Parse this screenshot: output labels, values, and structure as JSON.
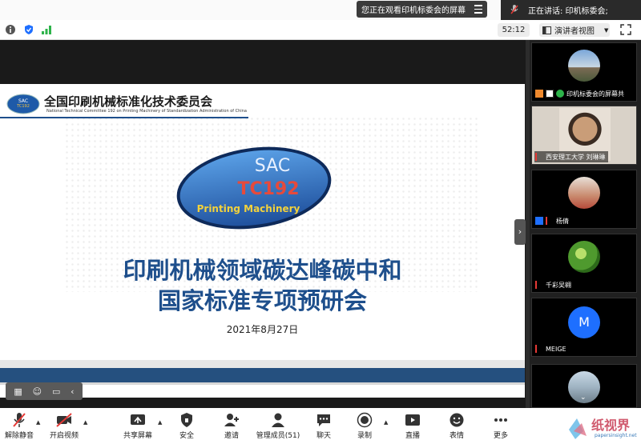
{
  "topbar": {
    "viewing_text": "您正在观看印机标委会的屏幕",
    "speaking_text": "正在讲话: 印机标委会;"
  },
  "toolbar2": {
    "timer": "52:12",
    "view_label": "演讲者视图"
  },
  "slide": {
    "org_name": "全国印刷机械标准化技术委员会",
    "org_subtitle": "National Technical Committee 192 on Printing Machinery of Standardization Administration of China",
    "logo_sac": "SAC",
    "logo_tc": "TC192",
    "logo_pm": "Printing Machinery",
    "org_logo_small": "SAC TC192",
    "title_line1": "印刷机械领域碳达峰碳中和",
    "title_line2": "国家标准专项预研会",
    "date": "2021年8月27日"
  },
  "participants": [
    {
      "name": "印机标委会的屏幕共"
    },
    {
      "name": "西安理工大学 刘琳琳"
    },
    {
      "name": "杨倩"
    },
    {
      "name": "千彩吴翱"
    },
    {
      "name": "MEIGE",
      "initial": "M"
    },
    {
      "name": ""
    }
  ],
  "bottombar": {
    "unmute": "解除静音",
    "start_video": "开启视频",
    "share_screen": "共享屏幕",
    "security": "安全",
    "invite": "邀请",
    "manage_participants": "管理成员(51)",
    "chat": "聊天",
    "record": "录制",
    "live": "直播",
    "reactions": "表情",
    "more": "更多"
  },
  "watermark": {
    "text": "纸视界",
    "url": "papersinsight.net"
  },
  "colors": {
    "slide_blue": "#1e4f8c",
    "avatar_blue": "#1e6fff",
    "muted_red": "#e53935"
  }
}
